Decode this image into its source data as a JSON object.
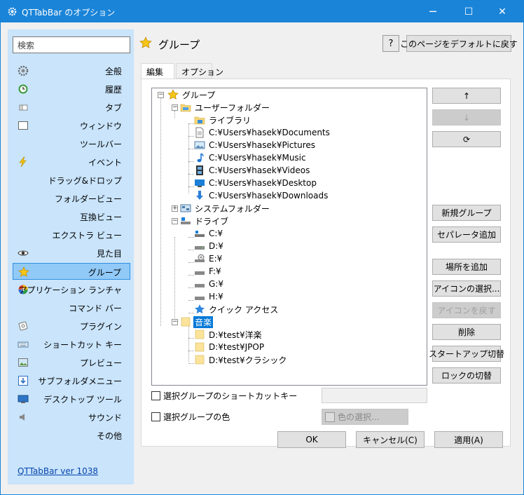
{
  "window": {
    "title": "QTTabBar のオプション",
    "controls": {
      "minimize": "─",
      "maximize": "☐",
      "close": "✕"
    }
  },
  "sidebar": {
    "search_placeholder": "検索",
    "items": [
      {
        "label": "全般",
        "icon": "gear-icon"
      },
      {
        "label": "履歴",
        "icon": "history-icon"
      },
      {
        "label": "タブ",
        "icon": "tab-icon"
      },
      {
        "label": "ウィンドウ",
        "icon": "window-icon"
      },
      {
        "label": "ツールバー",
        "icon": ""
      },
      {
        "label": "イベント",
        "icon": "lightning-icon"
      },
      {
        "label": "ドラッグ&ドロップ",
        "icon": ""
      },
      {
        "label": "フォルダービュー",
        "icon": ""
      },
      {
        "label": "互換ビュー",
        "icon": ""
      },
      {
        "label": "エクストラ ビュー",
        "icon": ""
      },
      {
        "label": "見た目",
        "icon": "eye-icon"
      },
      {
        "label": "グループ",
        "icon": "star-icon",
        "selected": true
      },
      {
        "label": "アプリケーション ランチャ",
        "icon": "app-launcher-icon"
      },
      {
        "label": "コマンド バー",
        "icon": ""
      },
      {
        "label": "プラグイン",
        "icon": "plugin-icon"
      },
      {
        "label": "ショートカット キー",
        "icon": "keyboard-icon"
      },
      {
        "label": "プレビュー",
        "icon": "preview-icon"
      },
      {
        "label": "サブフォルダメニュー",
        "icon": "subfolder-menu-icon"
      },
      {
        "label": "デスクトップ ツール",
        "icon": "desktop-icon"
      },
      {
        "label": "サウンド",
        "icon": "speaker-icon"
      },
      {
        "label": "その他",
        "icon": ""
      }
    ],
    "version_link": "QTTabBar ver 1038"
  },
  "header": {
    "title": "グループ",
    "help_label": "?",
    "default_button": "このページをデフォルトに戻す"
  },
  "tabs": [
    {
      "label": "編集",
      "active": true
    },
    {
      "label": "オプション",
      "active": false
    }
  ],
  "tree": {
    "root": "グループ",
    "user_folder": "ユーザーフォルダー",
    "library": "ライブラリ",
    "user_paths": [
      "C:¥Users¥hasek¥Documents",
      "C:¥Users¥hasek¥Pictures",
      "C:¥Users¥hasek¥Music",
      "C:¥Users¥hasek¥Videos",
      "C:¥Users¥hasek¥Desktop",
      "C:¥Users¥hasek¥Downloads"
    ],
    "system_folder": "システムフォルダー",
    "drives_label": "ドライブ",
    "drives": [
      "C:¥",
      "D:¥",
      "E:¥",
      "F:¥",
      "G:¥",
      "H:¥"
    ],
    "quick_access": "クイック アクセス",
    "music_group": "音楽",
    "music_paths": [
      "D:¥test¥洋楽",
      "D:¥test¥JPOP",
      "D:¥test¥クラシック"
    ]
  },
  "side_buttons": {
    "up": "↑",
    "down": "↓",
    "refresh": "⟳",
    "new_group": "新規グループ",
    "add_separator": "セパレータ追加",
    "add_location": "場所を追加",
    "select_icon": "アイコンの選択...",
    "reset_icon": "アイコンを戻す",
    "delete": "削除",
    "startup_toggle": "スタートアップ切替",
    "lock_toggle": "ロックの切替"
  },
  "options": {
    "shortcut_label": "選択グループのショートカットキー",
    "color_label": "選択グループの色",
    "color_button": "色の選択..."
  },
  "footer": {
    "ok": "OK",
    "cancel": "キャンセル(C)",
    "apply": "適用(A)"
  },
  "colors": {
    "titlebar": "#1a84d8",
    "sidebar_bg": "#c9e4fb",
    "selection": "#0078d7",
    "folder": "#f8d775"
  }
}
